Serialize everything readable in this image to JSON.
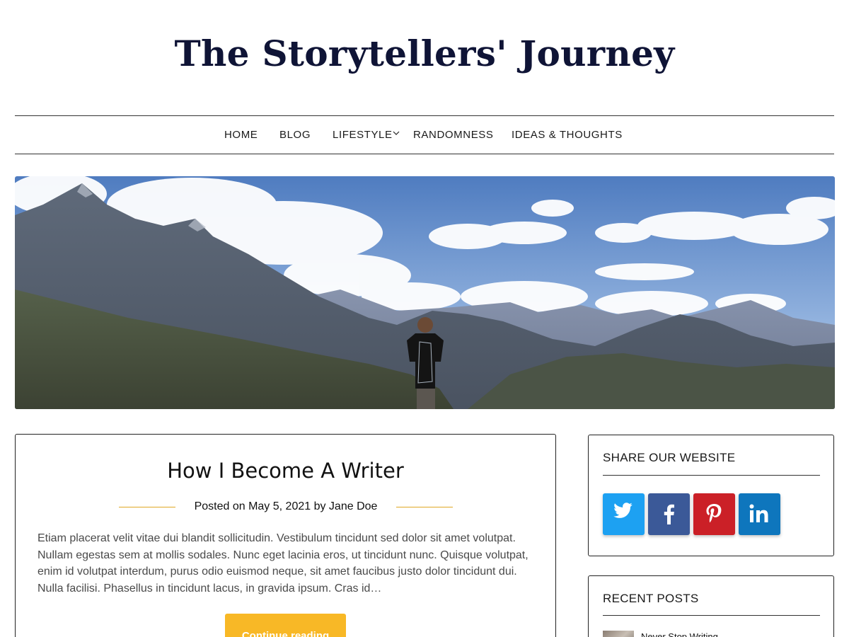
{
  "site": {
    "title": "The Storytellers' Journey"
  },
  "nav": {
    "items": [
      {
        "label": "HOME"
      },
      {
        "label": "BLOG"
      },
      {
        "label": "LIFESTYLE"
      },
      {
        "label": "RANDOMNESS"
      },
      {
        "label": "IDEAS & THOUGHTS"
      }
    ],
    "dropdown_icon": "chevron-down-icon"
  },
  "hero": {
    "image": "mountain-landscape-hiker"
  },
  "post": {
    "title": "How I Become A Writer",
    "meta": "Posted on May 5, 2021 by Jane Doe",
    "excerpt": "Etiam placerat velit vitae dui blandit sollicitudin. Vestibulum tincidunt sed dolor sit amet volutpat. Nullam egestas sem at mollis sodales. Nunc eget lacinia eros, ut tincidunt nunc. Quisque volutpat, enim id volutpat interdum, purus odio euismod neque, sit amet faucibus justo dolor tincidunt dui. Nulla facilisi. Phasellus in tincidunt lacus, in gravida ipsum. Cras id…",
    "read_more_label": "Continue reading",
    "accent_color": "#f8b826"
  },
  "sidebar": {
    "share": {
      "title": "SHARE OUR WEBSITE",
      "buttons": [
        {
          "icon": "twitter-icon",
          "color": "#1da1f2"
        },
        {
          "icon": "facebook-icon",
          "color": "#3b5998"
        },
        {
          "icon": "pinterest-icon",
          "color": "#cb2027"
        },
        {
          "icon": "linkedin-icon",
          "color": "#0e76bd"
        }
      ]
    },
    "recent": {
      "title": "RECENT POSTS",
      "items": [
        {
          "label": "Never Stop Writing"
        }
      ]
    }
  }
}
